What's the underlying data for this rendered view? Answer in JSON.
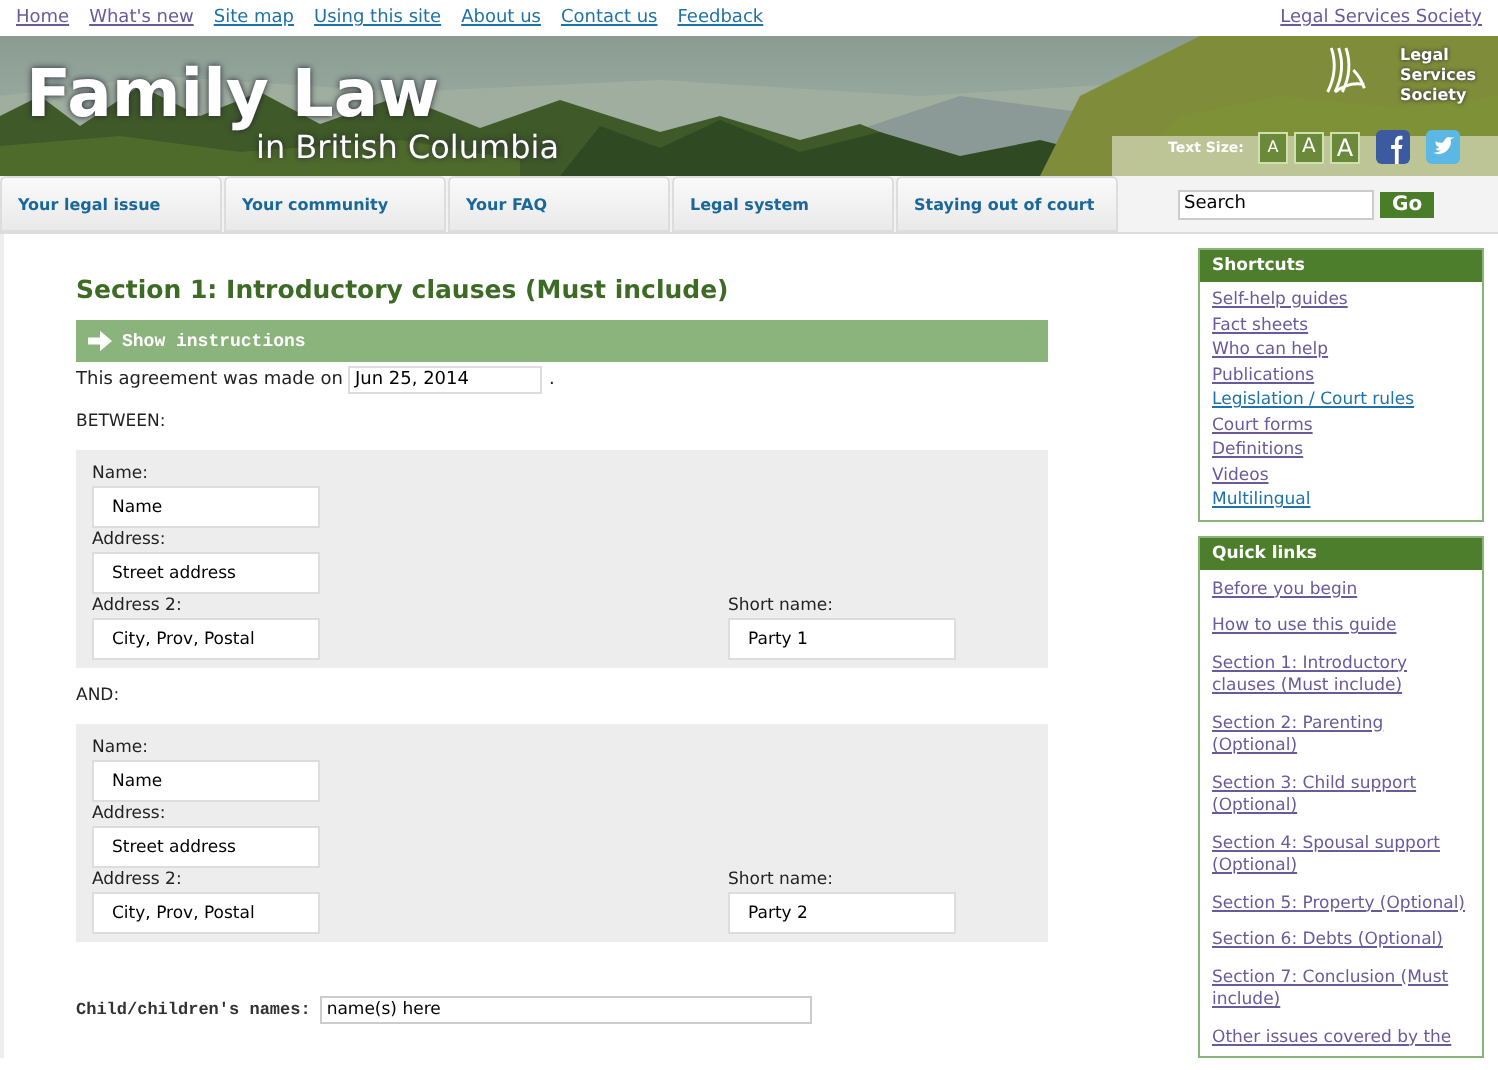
{
  "top_links": [
    {
      "label": "Home",
      "visited": true
    },
    {
      "label": "What's new",
      "visited": true
    },
    {
      "label": "Site map",
      "visited": false
    },
    {
      "label": "Using this site",
      "visited": false
    },
    {
      "label": "About us",
      "visited": false
    },
    {
      "label": "Contact us",
      "visited": false
    },
    {
      "label": "Feedback",
      "visited": false
    }
  ],
  "org_link": {
    "label": "Legal Services Society",
    "visited": true
  },
  "banner": {
    "kind": "picture",
    "title": "Family Law",
    "subtitle": "in British Columbia",
    "logo_text": "Legal Services Society",
    "text_size_label": "Text Size:",
    "text_size_buttons": [
      "A",
      "A",
      "A"
    ]
  },
  "nav": [
    {
      "label": "Your legal issue"
    },
    {
      "label": "Your community"
    },
    {
      "label": "Your FAQ"
    },
    {
      "label": "Legal system"
    },
    {
      "label": "Staying out of court"
    }
  ],
  "search": {
    "value": "Search",
    "button": "Go"
  },
  "main": {
    "heading": "Section 1: Introductory clauses (Must include)",
    "instructions_toggle": "Show instructions",
    "agreement_text": "This agreement was made on",
    "date": "Jun 25, 2014",
    "period": ".",
    "parties": [
      {
        "intro": "BETWEEN:",
        "name_label": "Name:",
        "name": "Name",
        "address_label": "Address:",
        "address": "Street address",
        "address2_label": "Address 2:",
        "address2": "City, Prov, Postal",
        "short_label": "Short name:",
        "short_name": "Party 1"
      },
      {
        "intro": "AND:",
        "name_label": "Name:",
        "name": "Name",
        "address_label": "Address:",
        "address": "Street address",
        "address2_label": "Address 2:",
        "address2": "City, Prov, Postal",
        "short_label": "Short name:",
        "short_name": "Party 2"
      }
    ],
    "children_label": "Child/children's names:",
    "children_value": "name(s) here"
  },
  "sidebar": [
    {
      "title": "Shortcuts",
      "kind": "compact",
      "links": [
        {
          "label": "Self-help guides",
          "visited": true
        },
        {
          "label": "Fact sheets",
          "visited": true
        },
        {
          "label": "Who can help",
          "visited": true
        },
        {
          "label": "Publications",
          "visited": true
        },
        {
          "label": "Legislation / Court rules",
          "visited": false
        },
        {
          "label": "Court forms",
          "visited": true
        },
        {
          "label": "Definitions",
          "visited": true
        },
        {
          "label": "Videos",
          "visited": true
        },
        {
          "label": "Multilingual",
          "visited": false
        }
      ]
    },
    {
      "title": "Quick links",
      "kind": "spaced",
      "links": [
        {
          "label": "Before you begin",
          "visited": true
        },
        {
          "label": "How to use this guide",
          "visited": true
        },
        {
          "label": "Section 1: Introductory clauses (Must include)",
          "visited": true
        },
        {
          "label": "Section 2: Parenting (Optional)",
          "visited": true
        },
        {
          "label": "Section 3: Child support (Optional)",
          "visited": true
        },
        {
          "label": "Section 4: Spousal support (Optional)",
          "visited": true
        },
        {
          "label": "Section 5: Property (Optional)",
          "visited": true
        },
        {
          "label": "Section 6: Debts (Optional)",
          "visited": true
        },
        {
          "label": "Section 7: Conclusion (Must include)",
          "visited": true
        },
        {
          "label": "Other issues covered by the",
          "visited": true
        }
      ]
    }
  ]
}
